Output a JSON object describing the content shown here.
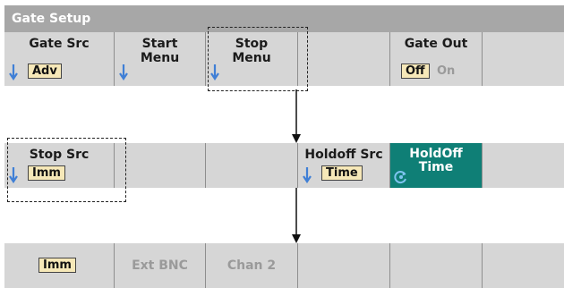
{
  "title": "Gate Setup",
  "row1": {
    "keys": [
      {
        "line1": "Gate Src",
        "value": "Adv"
      },
      {
        "line1": "Start",
        "line2": "Menu"
      },
      {
        "line1": "Stop",
        "line2": "Menu"
      },
      {
        "line1": ""
      },
      {
        "line1": "Gate Out",
        "opt_on": "Off",
        "opt_off": "On"
      },
      {
        "line1": ""
      }
    ]
  },
  "row2": {
    "keys": [
      {
        "line1": "Stop Src",
        "value": "Imm"
      },
      {
        "line1": ""
      },
      {
        "line1": ""
      },
      {
        "line1": "Holdoff Src",
        "value": "Time"
      },
      {
        "line1": "HoldOff",
        "line2": "Time"
      },
      {
        "line1": ""
      }
    ]
  },
  "row3": {
    "keys": [
      {
        "value": "Imm"
      },
      {
        "line1": "Ext BNC"
      },
      {
        "line1": "Chan 2"
      },
      {
        "line1": ""
      },
      {
        "line1": ""
      },
      {
        "line1": ""
      }
    ]
  },
  "colors": {
    "softkey": "#d6d6d6",
    "title_bar": "#a7a7a7",
    "selected_key": "#0f7f76",
    "value_box": "#f6e8b8",
    "down_arrow": "#3f7fd6"
  }
}
